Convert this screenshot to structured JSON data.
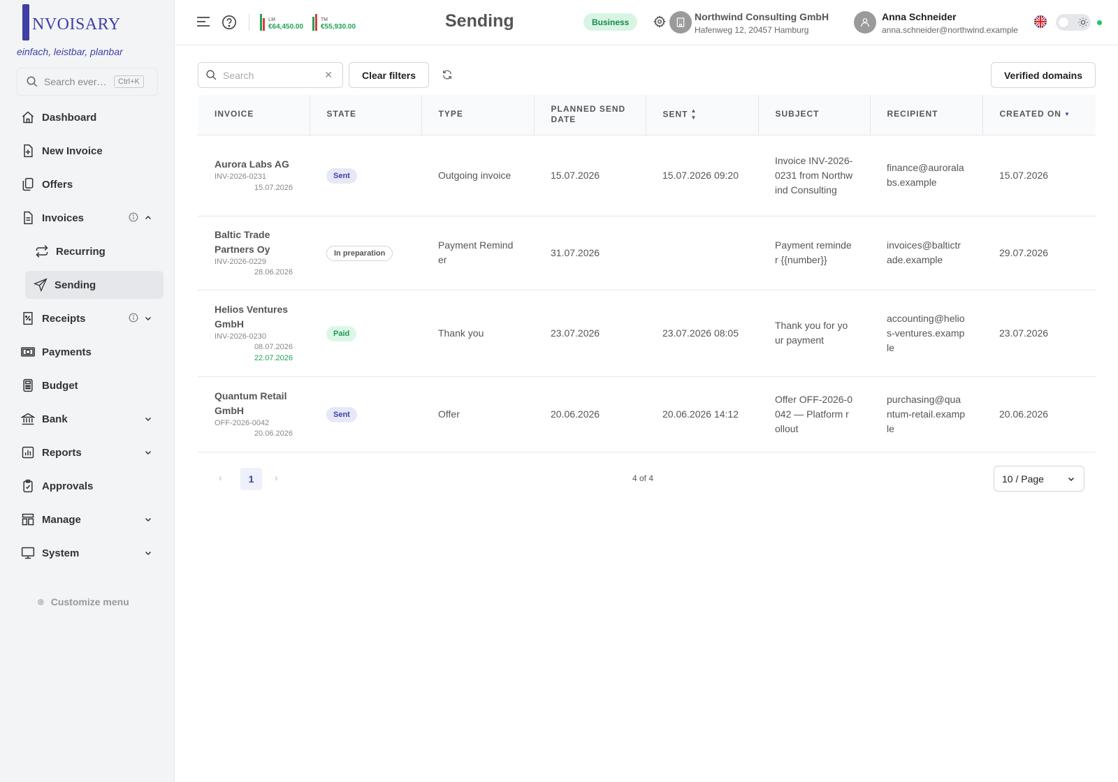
{
  "brand": {
    "logo_text": "NVOISARY",
    "tagline": "einfach, leistbar, planbar"
  },
  "sidebar": {
    "search_placeholder": "Search ever…",
    "search_shortcut": "Ctrl+K",
    "items": [
      {
        "label": "Dashboard",
        "icon": "home-icon"
      },
      {
        "label": "New Invoice",
        "icon": "file-plus-icon"
      },
      {
        "label": "Offers",
        "icon": "copy-icon"
      },
      {
        "label": "Invoices",
        "icon": "file-icon",
        "expanded": true
      },
      {
        "label": "Recurring",
        "icon": "repeat-icon"
      },
      {
        "label": "Sending",
        "icon": "send-icon",
        "active": true
      },
      {
        "label": "Receipts",
        "icon": "receipt-icon"
      },
      {
        "label": "Payments",
        "icon": "cash-icon"
      },
      {
        "label": "Budget",
        "icon": "calculator-icon"
      },
      {
        "label": "Bank",
        "icon": "bank-icon"
      },
      {
        "label": "Reports",
        "icon": "chart-icon"
      },
      {
        "label": "Approvals",
        "icon": "clipboard-check-icon"
      },
      {
        "label": "Manage",
        "icon": "layout-icon"
      },
      {
        "label": "System",
        "icon": "monitor-icon"
      }
    ],
    "customize_label": "Customize menu"
  },
  "header": {
    "kpi_last_month": {
      "label": "LM",
      "value": "€64,450.00"
    },
    "kpi_this_month": {
      "label": "TM",
      "value": "€55,930.00"
    },
    "title": "Sending",
    "plan_badge": "Business",
    "company_name": "Northwind Consulting GmbH",
    "company_address": "Hafenweg 12, 20457 Hamburg",
    "user_name": "Anna Schneider",
    "user_email": "anna.schneider@northwind.example",
    "status_color": "#22c55e"
  },
  "toolbar": {
    "search_placeholder": "Search",
    "clear_filters_label": "Clear filters",
    "verified_domains_label": "Verified domains"
  },
  "table": {
    "columns": [
      "INVOICE",
      "STATE",
      "TYPE",
      "PLANNED SEND DATE",
      "SENT",
      "SUBJECT",
      "RECIPIENT",
      "CREATED ON"
    ],
    "rows": [
      {
        "client": "Aurora Labs AG",
        "number": "INV-2026-0231",
        "date": "15.07.2026",
        "paid_date": "",
        "state": "Sent",
        "state_kind": "sent",
        "type": "Outgoing invoice",
        "planned": "15.07.2026",
        "sent": "15.07.2026 09:20",
        "subject": "Invoice INV-2026-0231 from Northwind Consulting",
        "recipient": "finance@auroralabs.example",
        "created": "15.07.2026"
      },
      {
        "client": "Baltic Trade Partners Oy",
        "number": "INV-2026-0229",
        "date": "28.06.2026",
        "paid_date": "",
        "state": "In preparation",
        "state_kind": "prep",
        "type": "Payment Reminder",
        "planned": "31.07.2026",
        "sent": "",
        "subject": "Payment reminder {{number}}",
        "recipient": "invoices@baltictrade.example",
        "created": "29.07.2026"
      },
      {
        "client": "Helios Ventures GmbH",
        "number": "INV-2026-0230",
        "date": "08.07.2026",
        "paid_date": "22.07.2026",
        "state": "Paid",
        "state_kind": "paid",
        "type": "Thank you",
        "planned": "23.07.2026",
        "sent": "23.07.2026 08:05",
        "subject": "Thank you for your payment",
        "recipient": "accounting@helios-ventures.example",
        "created": "23.07.2026"
      },
      {
        "client": "Quantum Retail GmbH",
        "number": "OFF-2026-0042",
        "date": "20.06.2026",
        "paid_date": "",
        "state": "Sent",
        "state_kind": "sent",
        "type": "Offer",
        "planned": "20.06.2026",
        "sent": "20.06.2026 14:12",
        "subject": "Offer OFF-2026-0042 — Platform rollout",
        "recipient": "purchasing@quantum-retail.example",
        "created": "20.06.2026"
      }
    ]
  },
  "pagination": {
    "current_page": "1",
    "count_text": "4 of 4",
    "page_size": "10 / Page"
  }
}
